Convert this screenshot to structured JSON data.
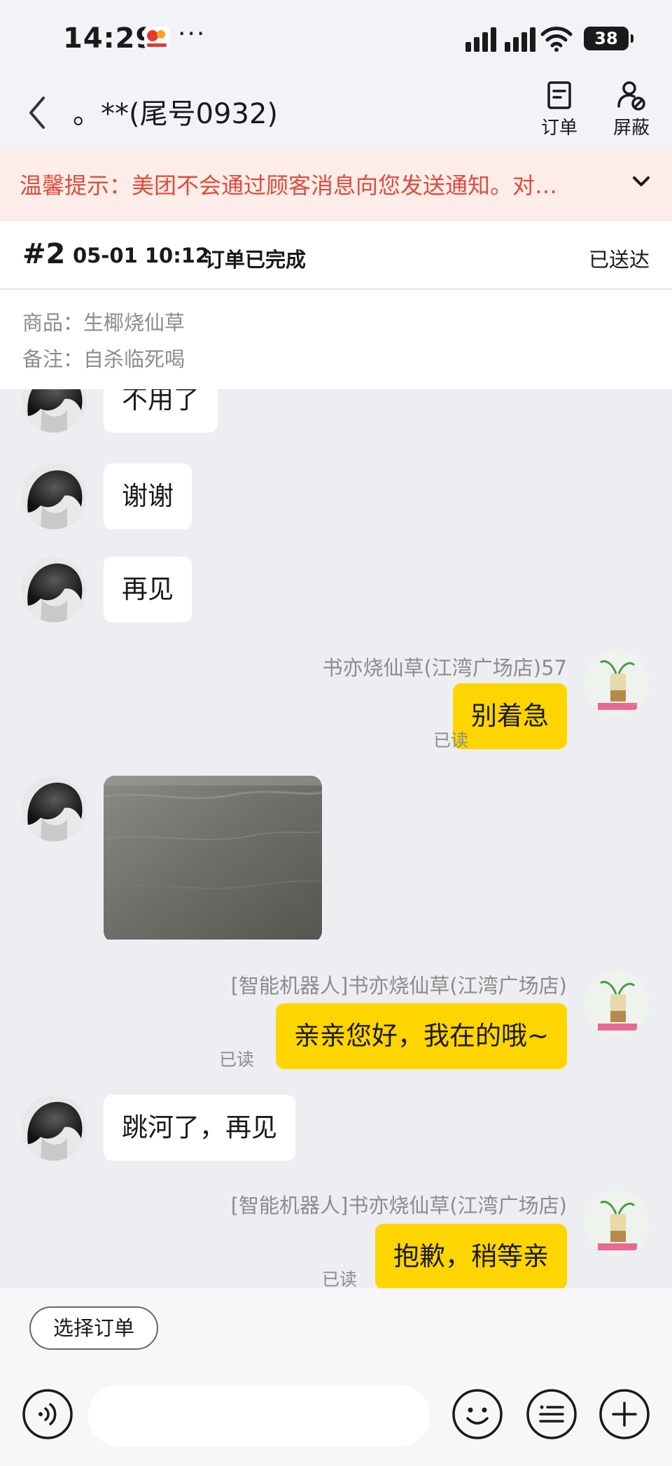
{
  "status_bar": {
    "time": "14:29",
    "dots": "···",
    "battery": "38"
  },
  "header": {
    "back_icon": "chevron-left-icon",
    "title": "。**(尾号0932)",
    "order_label": "订单",
    "block_label": "屏蔽"
  },
  "notice": {
    "text": "温馨提示：美团不会通过顾客消息向您发送通知。对…",
    "expand_icon": "chevron-down-icon",
    "color": "#E04B3A"
  },
  "order": {
    "number": "#2",
    "time": "05-01 10:12",
    "state": "订单已完成",
    "delivery_status": "已送达",
    "product": "商品：生椰烧仙草",
    "note": "备注：自杀临死喝"
  },
  "messages": {
    "m1": {
      "text": "不用了"
    },
    "m2": {
      "text": "谢谢"
    },
    "m3": {
      "text": "再见"
    },
    "m4": {
      "sender": "书亦烧仙草(江湾广场店)57",
      "text": "别着急",
      "read": "已读"
    },
    "m6": {
      "sender": "[智能机器人]书亦烧仙草(江湾广场店)",
      "text": "亲亲您好，我在的哦~",
      "read": "已读"
    },
    "m7": {
      "text": "跳河了，再见"
    },
    "m8": {
      "sender": "[智能机器人]书亦烧仙草(江湾广场店)",
      "text": "抱歉，稍等亲",
      "read": "已读"
    }
  },
  "composer": {
    "select_order_label": "选择订单",
    "input_placeholder": "",
    "icons": [
      "voice-icon",
      "emoji-icon",
      "quick-reply-icon",
      "plus-icon"
    ]
  },
  "colors": {
    "outgoing_bubble": "#FFD500",
    "incoming_bubble": "#FFFFFF",
    "background": "#EDEEF2"
  }
}
